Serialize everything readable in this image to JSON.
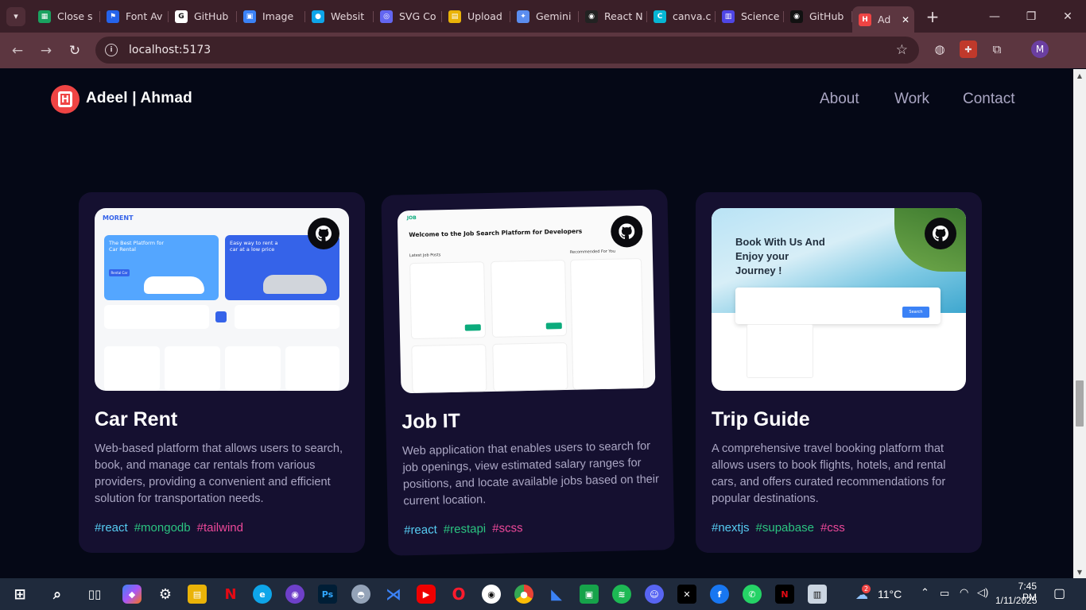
{
  "browser": {
    "tabs": [
      {
        "label": "Close s",
        "color": "#1aa260",
        "glyph": "▦"
      },
      {
        "label": "Font Av",
        "color": "#2563eb",
        "glyph": "⚑"
      },
      {
        "label": "GitHub",
        "color": "#ffffff",
        "glyph": "G"
      },
      {
        "label": "Image",
        "color": "#3b82f6",
        "glyph": "▣"
      },
      {
        "label": "Websit",
        "color": "#0ea5e9",
        "glyph": "●"
      },
      {
        "label": "SVG Co",
        "color": "#6366f1",
        "glyph": "◎"
      },
      {
        "label": "Upload",
        "color": "#eab308",
        "glyph": "▤"
      },
      {
        "label": "Gemini",
        "color": "#5b8def",
        "glyph": "✦"
      },
      {
        "label": "React N",
        "color": "#222222",
        "glyph": "◉"
      },
      {
        "label": "canva.c",
        "color": "#06b6d4",
        "glyph": "C"
      },
      {
        "label": "Science",
        "color": "#4f46e5",
        "glyph": "▥"
      },
      {
        "label": "GitHub",
        "color": "#111111",
        "glyph": "◉"
      }
    ],
    "active_tab": {
      "label": "Ad",
      "close": "✕"
    },
    "url": "localhost:5173",
    "profile_initial": "M"
  },
  "site": {
    "name": "Adeel | Ahmad",
    "nav": [
      "About",
      "Work",
      "Contact"
    ]
  },
  "projects": [
    {
      "title": "Car Rent",
      "description": "Web-based platform that allows users to search, book, and manage car rentals from various providers, providing a convenient and efficient solution for transportation needs.",
      "tags": [
        {
          "name": "#react",
          "color": "#56ccf2"
        },
        {
          "name": "#mongodb",
          "color": "#2bc480"
        },
        {
          "name": "#tailwind",
          "color": "#ec4899"
        }
      ],
      "preview": {
        "brand": "MORENT",
        "promo_1": "The Best Platform for Car Rental",
        "promo_2": "Easy way to rent a car at a low price",
        "cta": "Rental Car"
      }
    },
    {
      "title": "Job IT",
      "description": "Web application that enables users to search for job openings, view estimated salary ranges for positions, and locate available jobs based on their current location.",
      "tags": [
        {
          "name": "#react",
          "color": "#56ccf2"
        },
        {
          "name": "#restapi",
          "color": "#2bc480"
        },
        {
          "name": "#scss",
          "color": "#ec4899"
        }
      ],
      "preview": {
        "brand": "JOB",
        "heading": "Welcome to the Job Search Platform for Developers",
        "section": "Latest Job Posts",
        "side": "Recommended For You"
      }
    },
    {
      "title": "Trip Guide",
      "description": "A comprehensive travel booking platform that allows users to book flights, hotels, and rental cars, and offers curated recommendations for popular destinations.",
      "tags": [
        {
          "name": "#nextjs",
          "color": "#56ccf2"
        },
        {
          "name": "#supabase",
          "color": "#2bc480"
        },
        {
          "name": "#css",
          "color": "#ec4899"
        }
      ],
      "preview": {
        "headline": "Book With Us And Enjoy your Journey !",
        "search_button": "Search"
      }
    }
  ],
  "taskbar": {
    "weather_badge": "2",
    "temperature": "11°C",
    "time": "7:45 PM",
    "date": "1/11/2025"
  }
}
